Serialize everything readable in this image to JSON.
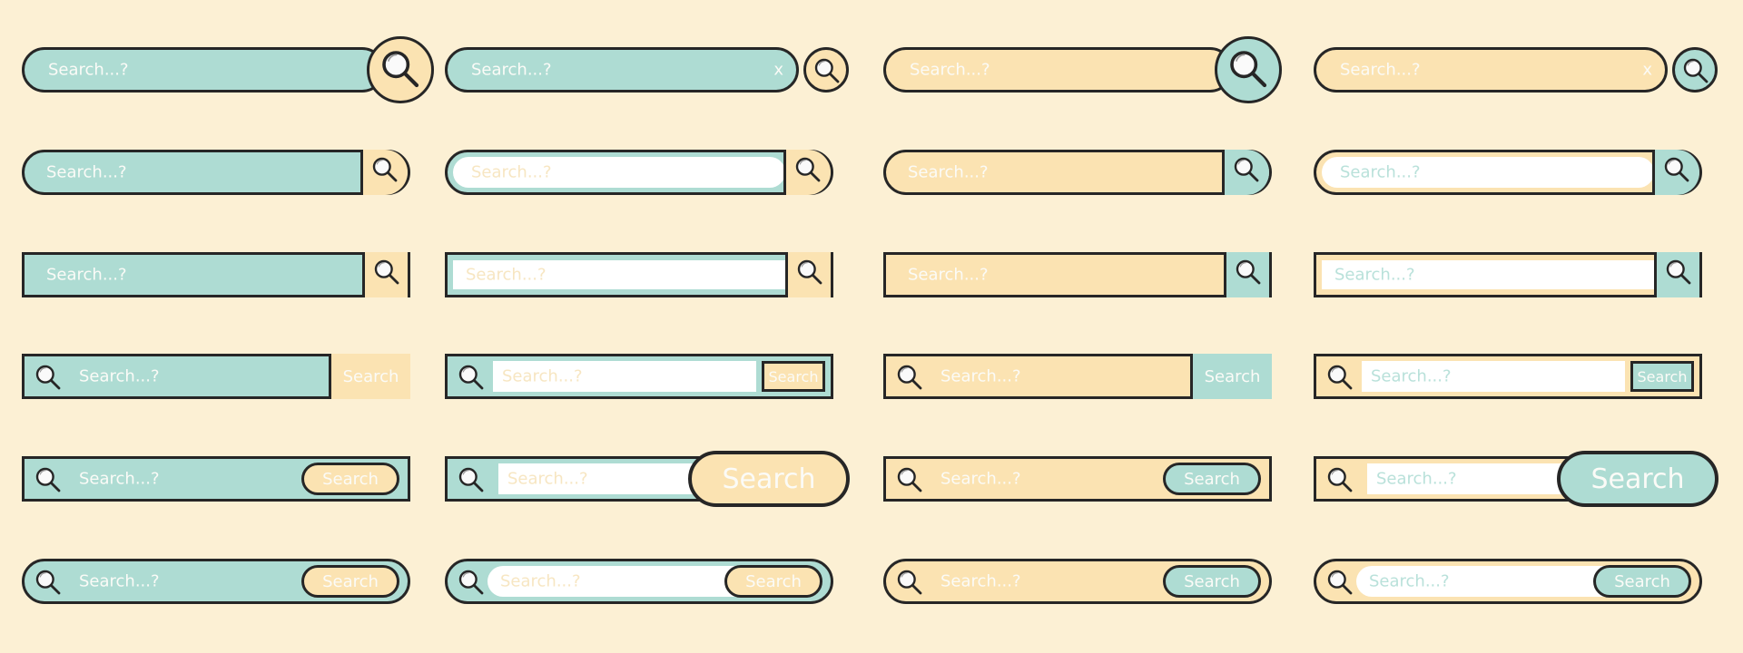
{
  "colors": {
    "background": "#fcf0d4",
    "teal": "#aedcd3",
    "peach": "#fbe3b2",
    "white": "#ffffff",
    "outline": "#262626"
  },
  "placeholder": "Search...?",
  "button_label": "Search",
  "clear_label": "x",
  "icons": {
    "search": "magnifier-icon",
    "clear": "x-icon"
  },
  "variants": [
    {
      "row": 1,
      "style": "pill with circular search button",
      "columns": [
        "teal",
        "teal-clear",
        "peach",
        "peach-clear"
      ]
    },
    {
      "row": 2,
      "style": "pill with square icon button",
      "columns": [
        "teal",
        "teal-white-input",
        "peach",
        "peach-white-input"
      ]
    },
    {
      "row": 3,
      "style": "rectangle with icon button",
      "columns": [
        "teal",
        "teal-white-input",
        "peach",
        "peach-white-input"
      ]
    },
    {
      "row": 4,
      "style": "rectangle with text Search button",
      "columns": [
        "teal",
        "teal-white-input",
        "peach",
        "peach-white-input"
      ]
    },
    {
      "row": 5,
      "style": "rectangle with pill Search button",
      "columns": [
        "teal",
        "teal-white-input-large-button",
        "peach",
        "peach-white-input-large-button"
      ]
    },
    {
      "row": 6,
      "style": "pill with inner pill Search button",
      "columns": [
        "teal",
        "teal-white-input",
        "peach",
        "peach-white-input"
      ]
    }
  ]
}
